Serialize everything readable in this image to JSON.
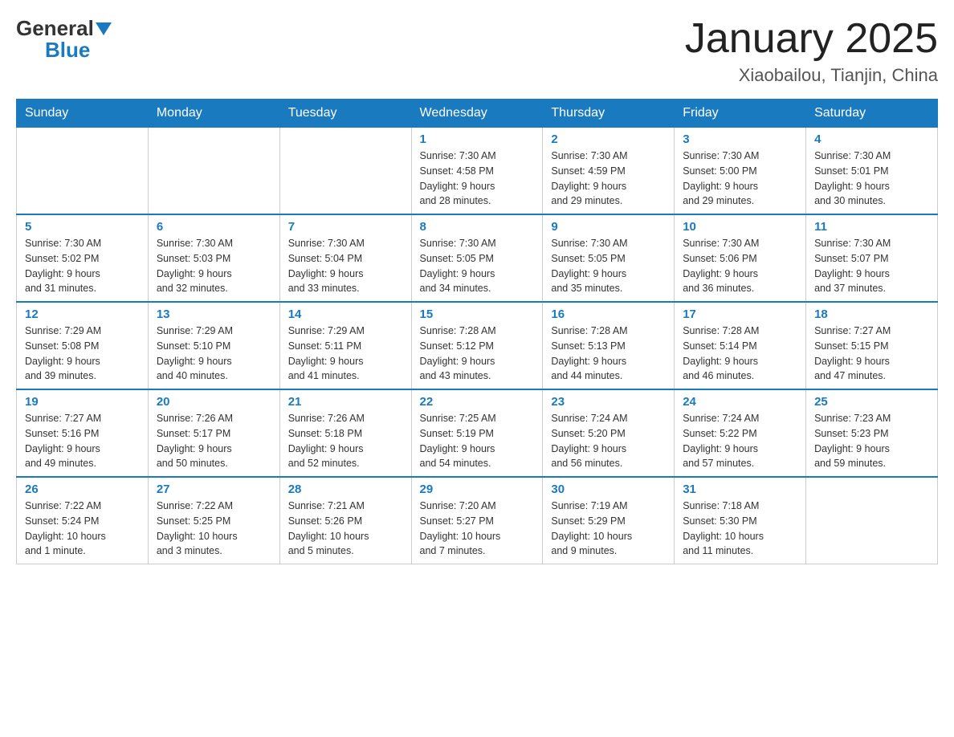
{
  "header": {
    "logo_general": "General",
    "logo_blue": "Blue",
    "month_title": "January 2025",
    "location": "Xiaobailou, Tianjin, China"
  },
  "weekdays": [
    "Sunday",
    "Monday",
    "Tuesday",
    "Wednesday",
    "Thursday",
    "Friday",
    "Saturday"
  ],
  "weeks": [
    [
      {
        "day": "",
        "info": ""
      },
      {
        "day": "",
        "info": ""
      },
      {
        "day": "",
        "info": ""
      },
      {
        "day": "1",
        "info": "Sunrise: 7:30 AM\nSunset: 4:58 PM\nDaylight: 9 hours\nand 28 minutes."
      },
      {
        "day": "2",
        "info": "Sunrise: 7:30 AM\nSunset: 4:59 PM\nDaylight: 9 hours\nand 29 minutes."
      },
      {
        "day": "3",
        "info": "Sunrise: 7:30 AM\nSunset: 5:00 PM\nDaylight: 9 hours\nand 29 minutes."
      },
      {
        "day": "4",
        "info": "Sunrise: 7:30 AM\nSunset: 5:01 PM\nDaylight: 9 hours\nand 30 minutes."
      }
    ],
    [
      {
        "day": "5",
        "info": "Sunrise: 7:30 AM\nSunset: 5:02 PM\nDaylight: 9 hours\nand 31 minutes."
      },
      {
        "day": "6",
        "info": "Sunrise: 7:30 AM\nSunset: 5:03 PM\nDaylight: 9 hours\nand 32 minutes."
      },
      {
        "day": "7",
        "info": "Sunrise: 7:30 AM\nSunset: 5:04 PM\nDaylight: 9 hours\nand 33 minutes."
      },
      {
        "day": "8",
        "info": "Sunrise: 7:30 AM\nSunset: 5:05 PM\nDaylight: 9 hours\nand 34 minutes."
      },
      {
        "day": "9",
        "info": "Sunrise: 7:30 AM\nSunset: 5:05 PM\nDaylight: 9 hours\nand 35 minutes."
      },
      {
        "day": "10",
        "info": "Sunrise: 7:30 AM\nSunset: 5:06 PM\nDaylight: 9 hours\nand 36 minutes."
      },
      {
        "day": "11",
        "info": "Sunrise: 7:30 AM\nSunset: 5:07 PM\nDaylight: 9 hours\nand 37 minutes."
      }
    ],
    [
      {
        "day": "12",
        "info": "Sunrise: 7:29 AM\nSunset: 5:08 PM\nDaylight: 9 hours\nand 39 minutes."
      },
      {
        "day": "13",
        "info": "Sunrise: 7:29 AM\nSunset: 5:10 PM\nDaylight: 9 hours\nand 40 minutes."
      },
      {
        "day": "14",
        "info": "Sunrise: 7:29 AM\nSunset: 5:11 PM\nDaylight: 9 hours\nand 41 minutes."
      },
      {
        "day": "15",
        "info": "Sunrise: 7:28 AM\nSunset: 5:12 PM\nDaylight: 9 hours\nand 43 minutes."
      },
      {
        "day": "16",
        "info": "Sunrise: 7:28 AM\nSunset: 5:13 PM\nDaylight: 9 hours\nand 44 minutes."
      },
      {
        "day": "17",
        "info": "Sunrise: 7:28 AM\nSunset: 5:14 PM\nDaylight: 9 hours\nand 46 minutes."
      },
      {
        "day": "18",
        "info": "Sunrise: 7:27 AM\nSunset: 5:15 PM\nDaylight: 9 hours\nand 47 minutes."
      }
    ],
    [
      {
        "day": "19",
        "info": "Sunrise: 7:27 AM\nSunset: 5:16 PM\nDaylight: 9 hours\nand 49 minutes."
      },
      {
        "day": "20",
        "info": "Sunrise: 7:26 AM\nSunset: 5:17 PM\nDaylight: 9 hours\nand 50 minutes."
      },
      {
        "day": "21",
        "info": "Sunrise: 7:26 AM\nSunset: 5:18 PM\nDaylight: 9 hours\nand 52 minutes."
      },
      {
        "day": "22",
        "info": "Sunrise: 7:25 AM\nSunset: 5:19 PM\nDaylight: 9 hours\nand 54 minutes."
      },
      {
        "day": "23",
        "info": "Sunrise: 7:24 AM\nSunset: 5:20 PM\nDaylight: 9 hours\nand 56 minutes."
      },
      {
        "day": "24",
        "info": "Sunrise: 7:24 AM\nSunset: 5:22 PM\nDaylight: 9 hours\nand 57 minutes."
      },
      {
        "day": "25",
        "info": "Sunrise: 7:23 AM\nSunset: 5:23 PM\nDaylight: 9 hours\nand 59 minutes."
      }
    ],
    [
      {
        "day": "26",
        "info": "Sunrise: 7:22 AM\nSunset: 5:24 PM\nDaylight: 10 hours\nand 1 minute."
      },
      {
        "day": "27",
        "info": "Sunrise: 7:22 AM\nSunset: 5:25 PM\nDaylight: 10 hours\nand 3 minutes."
      },
      {
        "day": "28",
        "info": "Sunrise: 7:21 AM\nSunset: 5:26 PM\nDaylight: 10 hours\nand 5 minutes."
      },
      {
        "day": "29",
        "info": "Sunrise: 7:20 AM\nSunset: 5:27 PM\nDaylight: 10 hours\nand 7 minutes."
      },
      {
        "day": "30",
        "info": "Sunrise: 7:19 AM\nSunset: 5:29 PM\nDaylight: 10 hours\nand 9 minutes."
      },
      {
        "day": "31",
        "info": "Sunrise: 7:18 AM\nSunset: 5:30 PM\nDaylight: 10 hours\nand 11 minutes."
      },
      {
        "day": "",
        "info": ""
      }
    ]
  ]
}
